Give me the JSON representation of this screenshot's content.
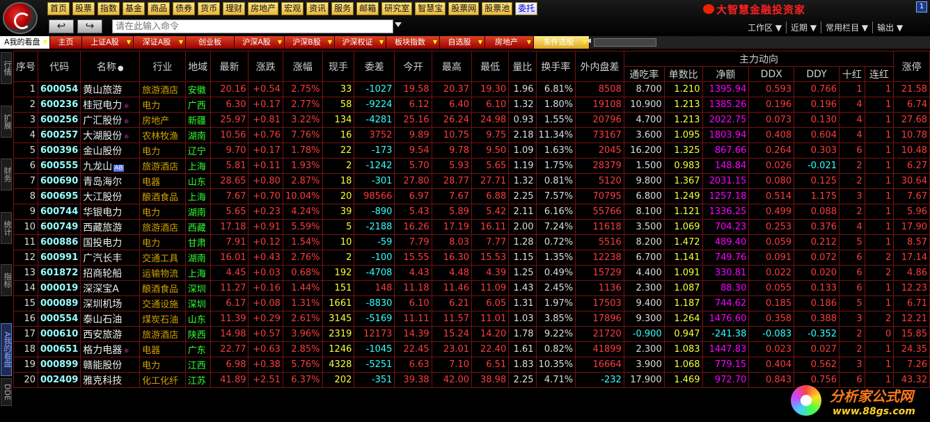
{
  "menu": [
    "首页",
    "股票",
    "指数",
    "基金",
    "商品",
    "债券",
    "货币",
    "理财",
    "房地产",
    "宏观",
    "资讯",
    "服务",
    "邮箱",
    "研究室",
    "智慧宝",
    "股票网",
    "股票池",
    "委托"
  ],
  "menu_active_index": 17,
  "brand": "大智慧金融投资家",
  "window_control": "1",
  "nav": {
    "back": "↩",
    "forward": "↪"
  },
  "command": {
    "placeholder": "请在此输入命令"
  },
  "right_menu": [
    "工作区 ▼",
    "近期 ▼",
    "常用栏目 ▼",
    "输出 ▼"
  ],
  "tabs": [
    {
      "label": "A我的看盘",
      "first": true,
      "drop": true
    },
    {
      "label": "主页"
    },
    {
      "label": "上证A股",
      "drop": true
    },
    {
      "label": "深证A股",
      "drop": true
    },
    {
      "label": "创业板"
    },
    {
      "label": "沪深A股",
      "drop": true
    },
    {
      "label": "沪深B股",
      "drop": true
    },
    {
      "label": "沪深权证",
      "drop": true
    },
    {
      "label": "板块指数",
      "drop": true
    },
    {
      "label": "自选股",
      "drop": true
    },
    {
      "label": "房地产",
      "drop": true
    },
    {
      "label": "条件选股",
      "drop": true,
      "active": true
    }
  ],
  "rail_tabs": [
    "行情",
    "扩展",
    "财务",
    "统计",
    "指标",
    "A我的看盘",
    "DDE"
  ],
  "rail_active": 5,
  "columns": [
    "序号",
    "代码",
    "名称",
    "行业",
    "地域",
    "最新",
    "涨跌",
    "涨幅",
    "现手",
    "委差",
    "今开",
    "最高",
    "最低",
    "量比",
    "换手率",
    "外内盘差"
  ],
  "main_force_title": "主力动向",
  "main_force_cols": [
    "通吃率",
    "单数比",
    "净额",
    "DDX",
    "DDY",
    "十红",
    "连红"
  ],
  "last_col": "涨停",
  "name_sort_marks": "●",
  "rows": [
    [
      "1",
      "600054",
      "黄山旅游",
      "",
      "旅游酒店",
      "安徽",
      "20.16",
      "+0.54",
      "2.75%",
      "33",
      "-1027",
      "19.58",
      "20.37",
      "19.30",
      "1.96",
      "6.81%",
      "8508",
      "8.700",
      "1.210",
      "1395.94",
      "0.593",
      "0.766",
      "1",
      "1",
      "21.58"
    ],
    [
      "2",
      "600236",
      "桂冠电力",
      "☼",
      "电力",
      "广西",
      "6.30",
      "+0.17",
      "2.77%",
      "58",
      "-9224",
      "6.12",
      "6.40",
      "6.10",
      "1.32",
      "1.80%",
      "19108",
      "10.900",
      "1.213",
      "1385.26",
      "0.196",
      "0.196",
      "4",
      "1",
      "6.74"
    ],
    [
      "3",
      "600256",
      "广汇股份",
      "☼",
      "房地产",
      "新疆",
      "25.97",
      "+0.81",
      "3.22%",
      "134",
      "-4281",
      "25.16",
      "26.24",
      "24.98",
      "0.93",
      "1.55%",
      "20796",
      "4.700",
      "1.213",
      "2022.75",
      "0.073",
      "0.130",
      "4",
      "1",
      "27.68"
    ],
    [
      "4",
      "600257",
      "大湖股份",
      "☼",
      "农林牧渔",
      "湖南",
      "10.56",
      "+0.76",
      "7.76%",
      "16",
      "3752",
      "9.89",
      "10.75",
      "9.75",
      "2.18",
      "11.34%",
      "73167",
      "3.600",
      "1.095",
      "1803.94",
      "0.408",
      "0.604",
      "4",
      "1",
      "10.78"
    ],
    [
      "5",
      "600396",
      "金山股份",
      "",
      "电力",
      "辽宁",
      "9.70",
      "+0.17",
      "1.78%",
      "22",
      "-173",
      "9.54",
      "9.78",
      "9.50",
      "1.09",
      "1.63%",
      "2045",
      "16.200",
      "1.325",
      "867.66",
      "0.264",
      "0.303",
      "6",
      "1",
      "10.48"
    ],
    [
      "6",
      "600555",
      "九龙山",
      "AB",
      "旅游酒店",
      "上海",
      "5.81",
      "+0.11",
      "1.93%",
      "2",
      "-1242",
      "5.70",
      "5.93",
      "5.65",
      "1.19",
      "1.75%",
      "28379",
      "1.500",
      "0.983",
      "148.84",
      "0.026",
      "-0.021",
      "2",
      "1",
      "6.27"
    ],
    [
      "7",
      "600690",
      "青岛海尔",
      "",
      "电器",
      "山东",
      "28.65",
      "+0.80",
      "2.87%",
      "18",
      "-301",
      "27.80",
      "28.77",
      "27.71",
      "1.32",
      "0.81%",
      "5120",
      "9.800",
      "1.367",
      "2031.15",
      "0.080",
      "0.125",
      "2",
      "1",
      "30.64"
    ],
    [
      "8",
      "600695",
      "大江股份",
      "",
      "酿酒食品",
      "上海",
      "7.67",
      "+0.70",
      "10.04%",
      "20",
      "98566",
      "6.97",
      "7.67",
      "6.88",
      "2.25",
      "7.57%",
      "70795",
      "6.800",
      "1.249",
      "1257.18",
      "0.514",
      "1.175",
      "3",
      "1",
      "7.67"
    ],
    [
      "9",
      "600744",
      "华银电力",
      "",
      "电力",
      "湖南",
      "5.65",
      "+0.23",
      "4.24%",
      "39",
      "-890",
      "5.43",
      "5.89",
      "5.42",
      "2.11",
      "6.16%",
      "55766",
      "8.100",
      "1.121",
      "1336.25",
      "0.499",
      "0.088",
      "2",
      "1",
      "5.96"
    ],
    [
      "10",
      "600749",
      "西藏旅游",
      "",
      "旅游酒店",
      "西藏",
      "17.18",
      "+0.91",
      "5.59%",
      "5",
      "-2188",
      "16.26",
      "17.19",
      "16.11",
      "2.00",
      "7.24%",
      "11618",
      "3.500",
      "1.069",
      "704.23",
      "0.253",
      "0.376",
      "4",
      "1",
      "17.90"
    ],
    [
      "11",
      "600886",
      "国投电力",
      "",
      "电力",
      "甘肃",
      "7.91",
      "+0.12",
      "1.54%",
      "10",
      "-59",
      "7.79",
      "8.03",
      "7.77",
      "1.28",
      "0.72%",
      "5516",
      "8.200",
      "1.472",
      "489.40",
      "0.059",
      "0.212",
      "5",
      "1",
      "8.57"
    ],
    [
      "12",
      "600991",
      "广汽长丰",
      "",
      "交通工具",
      "湖南",
      "16.01",
      "+0.43",
      "2.76%",
      "2",
      "-100",
      "15.55",
      "16.30",
      "15.53",
      "1.15",
      "1.35%",
      "12238",
      "6.700",
      "1.141",
      "749.76",
      "0.091",
      "0.072",
      "6",
      "2",
      "17.14"
    ],
    [
      "13",
      "601872",
      "招商轮船",
      "",
      "运输物流",
      "上海",
      "4.45",
      "+0.03",
      "0.68%",
      "192",
      "-4708",
      "4.43",
      "4.48",
      "4.39",
      "1.25",
      "0.49%",
      "15729",
      "4.400",
      "1.091",
      "330.81",
      "0.022",
      "0.020",
      "6",
      "2",
      "4.86"
    ],
    [
      "14",
      "000019",
      "深深宝A",
      "",
      "酿酒食品",
      "深圳",
      "11.27",
      "+0.16",
      "1.44%",
      "151",
      "148",
      "11.18",
      "11.46",
      "11.09",
      "1.43",
      "2.45%",
      "1136",
      "2.300",
      "1.087",
      "88.30",
      "0.055",
      "0.133",
      "6",
      "1",
      "12.23"
    ],
    [
      "15",
      "000089",
      "深圳机场",
      "",
      "交通设施",
      "深圳",
      "6.17",
      "+0.08",
      "1.31%",
      "1661",
      "-8830",
      "6.10",
      "6.21",
      "6.05",
      "1.31",
      "1.97%",
      "17503",
      "9.400",
      "1.187",
      "744.62",
      "0.185",
      "0.186",
      "5",
      "1",
      "6.71"
    ],
    [
      "16",
      "000554",
      "泰山石油",
      "",
      "煤炭石油",
      "山东",
      "11.39",
      "+0.29",
      "2.61%",
      "3145",
      "-5169",
      "11.11",
      "11.57",
      "11.01",
      "1.03",
      "3.85%",
      "17896",
      "9.300",
      "1.264",
      "1476.60",
      "0.358",
      "0.388",
      "3",
      "2",
      "12.21"
    ],
    [
      "17",
      "000610",
      "西安旅游",
      "",
      "旅游酒店",
      "陕西",
      "14.98",
      "+0.57",
      "3.96%",
      "2319",
      "12173",
      "14.39",
      "15.24",
      "14.20",
      "1.78",
      "9.22%",
      "21720",
      "-0.900",
      "0.947",
      "-241.38",
      "-0.083",
      "-0.352",
      "2",
      "0",
      "15.85"
    ],
    [
      "18",
      "000651",
      "格力电器",
      "☼",
      "电器",
      "广东",
      "22.77",
      "+0.63",
      "2.85%",
      "1246",
      "-1045",
      "22.45",
      "23.01",
      "22.40",
      "1.61",
      "0.82%",
      "41899",
      "2.300",
      "1.083",
      "1447.83",
      "0.023",
      "0.027",
      "2",
      "1",
      "24.35"
    ],
    [
      "19",
      "000899",
      "赣能股份",
      "",
      "电力",
      "江西",
      "6.98",
      "+0.38",
      "5.76%",
      "4328",
      "-5251",
      "6.63",
      "7.10",
      "6.51",
      "1.83",
      "10.35%",
      "16664",
      "3.900",
      "1.068",
      "779.15",
      "0.404",
      "0.562",
      "3",
      "1",
      "7.26"
    ],
    [
      "20",
      "002409",
      "雅克科技",
      "",
      "化工化纤",
      "江苏",
      "41.89",
      "+2.51",
      "6.37%",
      "202",
      "-351",
      "39.38",
      "42.00",
      "38.98",
      "2.25",
      "4.71%",
      "-232",
      "17.900",
      "1.469",
      "972.70",
      "0.843",
      "0.756",
      "6",
      "1",
      "43.32"
    ]
  ],
  "watermark": {
    "title": "分析家公式网",
    "url": "www.88gs.com"
  },
  "colors": {
    "rise": "#ff3b3b",
    "fall": "#33ffff",
    "industry": "#d4a000",
    "region": "#33ff33",
    "net_amount": "#ff00ff",
    "ddx": "#ffff33",
    "grid_border": "#7a1010"
  }
}
